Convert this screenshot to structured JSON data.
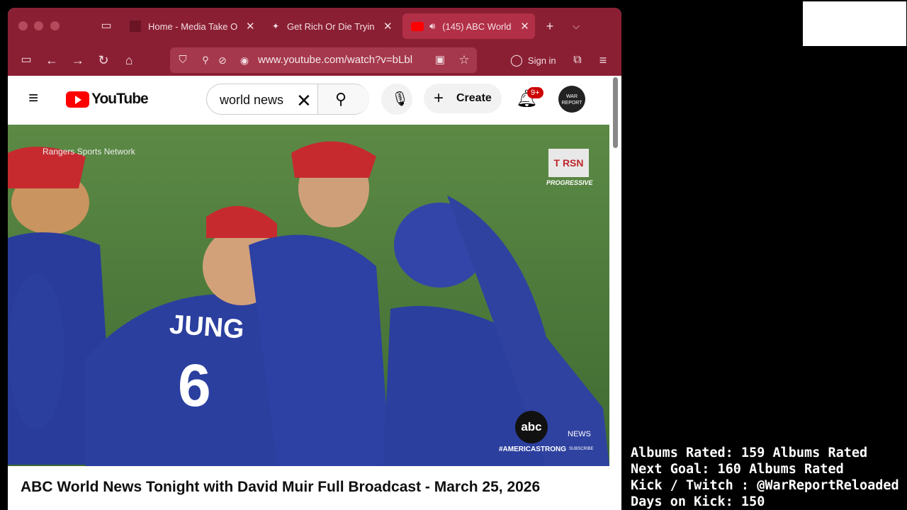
{
  "tabs": [
    {
      "title": "Home - Media Take O"
    },
    {
      "title": "Get Rich Or Die Tryin"
    },
    {
      "title": "(145) ABC World"
    }
  ],
  "url": "www.youtube.com/watch?v=bLbl",
  "signin_label": "Sign in",
  "youtube": {
    "logo": "YouTube",
    "search_value": "world news",
    "create_label": "Create",
    "notif_badge": "9+",
    "avatar_text": "WAR REPORT"
  },
  "video": {
    "channel_watermark": "Rangers Sports Network",
    "rsn_logo": "T RSN",
    "rsn_sub": "PROGRESSIVE",
    "abc_logo": "abc",
    "hashtag": "#AMERICASTRONG",
    "news_logo": "NEWS",
    "subscribe": "SUBSCRIBE",
    "jersey_name": "JUNG",
    "jersey_number": "6",
    "title": "ABC World News Tonight with David Muir Full Broadcast - March 25, 2026"
  },
  "overlay": {
    "albums": "Albums Rated: 159 Albums Rated",
    "goal": "Next Goal: 160 Albums Rated",
    "socials": "Kick / Twitch : @WarReportReloaded",
    "days": "Days on Kick: 150"
  },
  "colors": {
    "browser_frame": "#8a1f33",
    "youtube_red": "#ff0000"
  }
}
